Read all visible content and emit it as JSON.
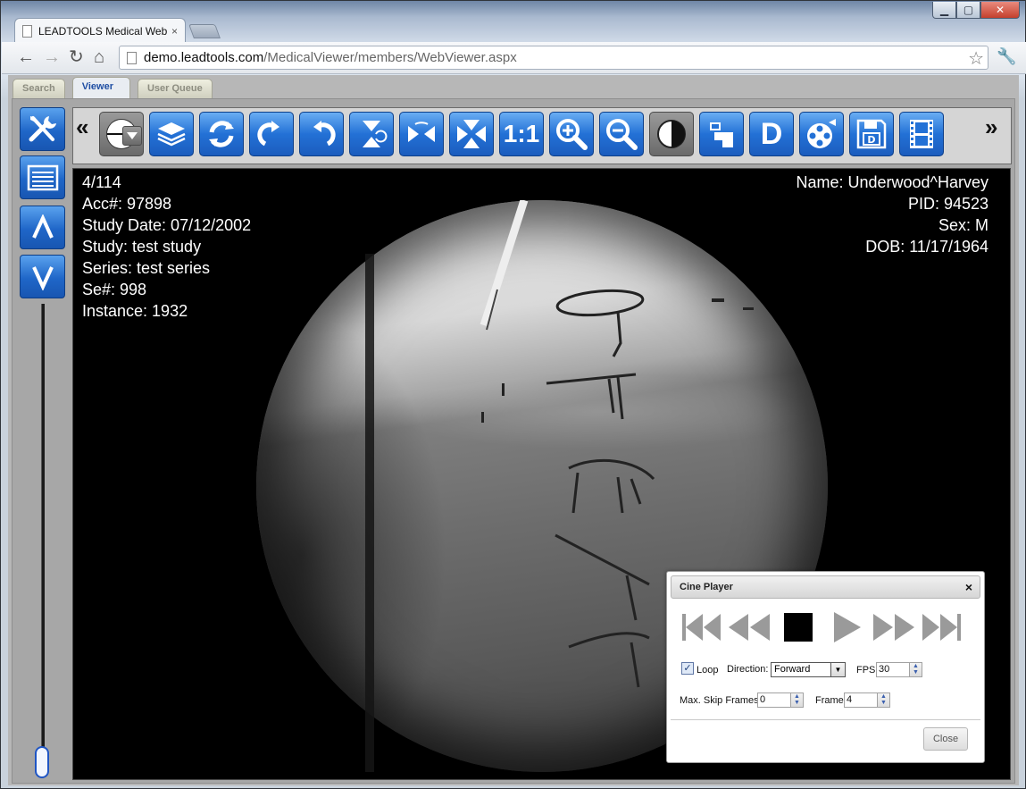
{
  "browser": {
    "tab_title": "LEADTOOLS Medical Web",
    "tab_close": "×",
    "url_host": "demo.leadtools.com",
    "url_path": "/MedicalViewer/members/WebViewer.aspx"
  },
  "app_tabs": [
    {
      "label": "Search"
    },
    {
      "label": "Viewer"
    },
    {
      "label": "User Queue"
    }
  ],
  "toolbar": {
    "scroll_left": "«",
    "scroll_right": "»",
    "one_to_one": "1:1",
    "d_label": "D"
  },
  "overlay_left": {
    "image_index": "4/114",
    "accession": "Acc#: 97898",
    "study_date": "Study Date: 07/12/2002",
    "study": "Study: test study",
    "series": "Series: test series",
    "series_number": "Se#: 998",
    "instance": "Instance: 1932"
  },
  "overlay_right": {
    "name": "Name: Underwood^Harvey",
    "pid": "PID: 94523",
    "sex": "Sex: M",
    "dob": "DOB: 11/17/1964"
  },
  "cine_player": {
    "title": "Cine Player",
    "close_x": "×",
    "loop_label": "Loop",
    "loop_checked": true,
    "direction_label": "Direction:",
    "direction_value": "Forward",
    "fps_label": "FPS:",
    "fps_value": "30",
    "max_skip_label": "Max. Skip Frames:",
    "max_skip_value": "0",
    "frame_label": "Frame:",
    "frame_value": "4",
    "close_button": "Close"
  },
  "colors": {
    "tool_blue": "#2371d6",
    "viewer_tab_text": "#1f4ea3",
    "viewport_bg": "#000000"
  }
}
